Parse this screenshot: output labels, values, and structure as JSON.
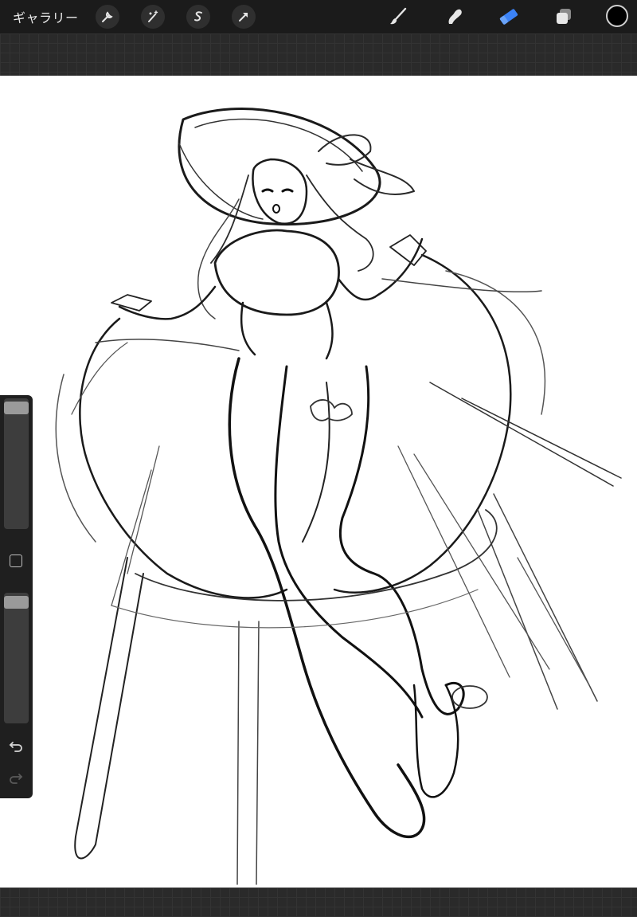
{
  "topbar": {
    "gallery_label": "ギャラリー",
    "left_tools": [
      "wrench-icon",
      "magic-wand-icon",
      "selection-s-icon",
      "transform-arrow-icon"
    ],
    "right_tools": [
      "brush-icon",
      "smudge-icon",
      "eraser-icon",
      "layers-icon"
    ],
    "active_tool": "eraser-icon",
    "active_color": "#000000",
    "accent_color": "#3b82f6"
  },
  "sidebar": {
    "brush_size_level": 0.0,
    "opacity_level": 0.0,
    "icons": [
      "modify-square-icon",
      "undo-icon",
      "redo-icon"
    ]
  },
  "canvas": {
    "background": "#ffffff",
    "content": "sketch"
  }
}
